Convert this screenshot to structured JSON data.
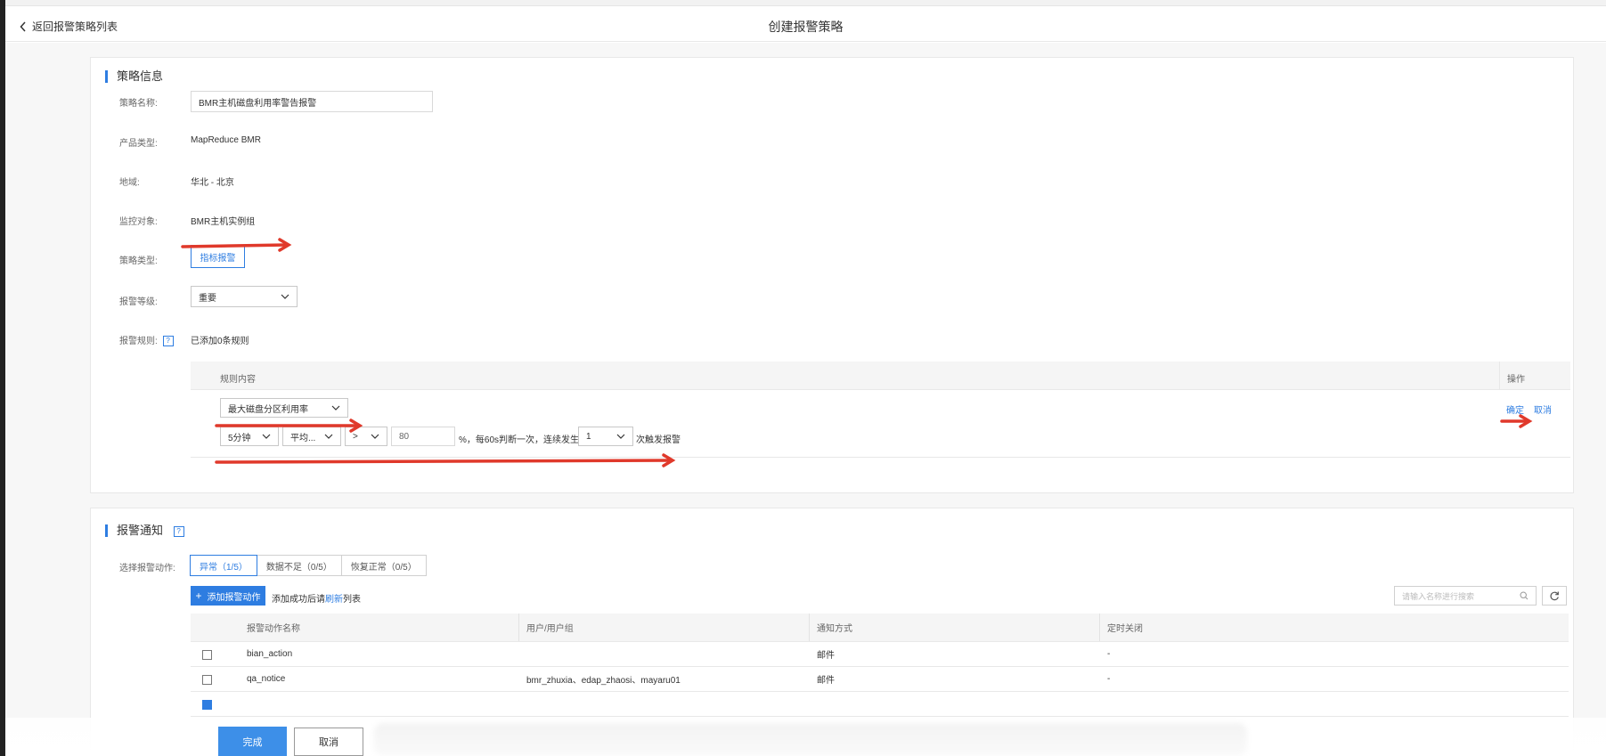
{
  "header": {
    "back_label": "返回报警策略列表",
    "title": "创建报警策略"
  },
  "policy": {
    "section_title": "策略信息",
    "name_label": "策略名称:",
    "name_value": "BMR主机磁盘利用率警告报警",
    "product_label": "产品类型:",
    "product_value": "MapReduce BMR",
    "region_label": "地域:",
    "region_value": "华北 - 北京",
    "target_label": "监控对象:",
    "target_value": "BMR主机实例组",
    "type_label": "策略类型:",
    "type_value": "指标报警",
    "level_label": "报警等级:",
    "level_value": "重要",
    "rules_label": "报警规则:",
    "rules_help": "?",
    "rules_count": "已添加0条规则",
    "rules_head_content": "规则内容",
    "rules_head_ops": "操作",
    "metric_value": "最大磁盘分区利用率",
    "period_value": "5分钟",
    "stat_value": "平均...",
    "op_value": ">",
    "threshold_value": "80",
    "mid_text": "%，每60s判断一次，连续发生",
    "count_value": "1",
    "tail_text": "次触发报警",
    "confirm_label": "确定",
    "cancel_label": "取消"
  },
  "notify": {
    "section_title": "报警通知",
    "help": "?",
    "action_label": "选择报警动作:",
    "tabs": [
      {
        "label": "异常（1/5）",
        "active": true
      },
      {
        "label": "数据不足（0/5）",
        "active": false
      },
      {
        "label": "恢复正常（0/5）",
        "active": false
      }
    ],
    "add_button": "添加报警动作",
    "hint_prefix": "添加成功后请",
    "hint_link": "刷新",
    "hint_suffix": "列表",
    "search_placeholder": "请输入名称进行搜索",
    "columns": [
      "报警动作名称",
      "用户/用户组",
      "通知方式",
      "定时关闭"
    ],
    "rows": [
      {
        "name": "bian_action",
        "users": "",
        "method": "邮件",
        "close": "-",
        "checked": false
      },
      {
        "name": "qa_notice",
        "users": "bmr_zhuxia、edap_zhaosi、mayaru01",
        "method": "邮件",
        "close": "-",
        "checked": false
      }
    ]
  },
  "footer": {
    "done_label": "完成",
    "cancel_label": "取消"
  },
  "colors": {
    "accent": "#2e7de1",
    "annotation_red": "#e0392b"
  }
}
